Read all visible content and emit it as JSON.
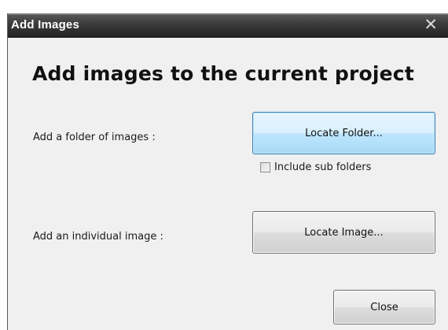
{
  "window": {
    "title": "Add Images",
    "close_glyph": "✕"
  },
  "heading": "Add images to the current project",
  "folder_section": {
    "label": "Add a folder of images :",
    "button_label": "Locate Folder...",
    "checkbox_label": "Include sub folders",
    "checkbox_checked": false
  },
  "image_section": {
    "label": "Add an individual image :",
    "button_label": "Locate Image..."
  },
  "footer": {
    "close_label": "Close"
  },
  "colors": {
    "focused_button": "#bee6fd",
    "titlebar": "#3a3a3a"
  }
}
